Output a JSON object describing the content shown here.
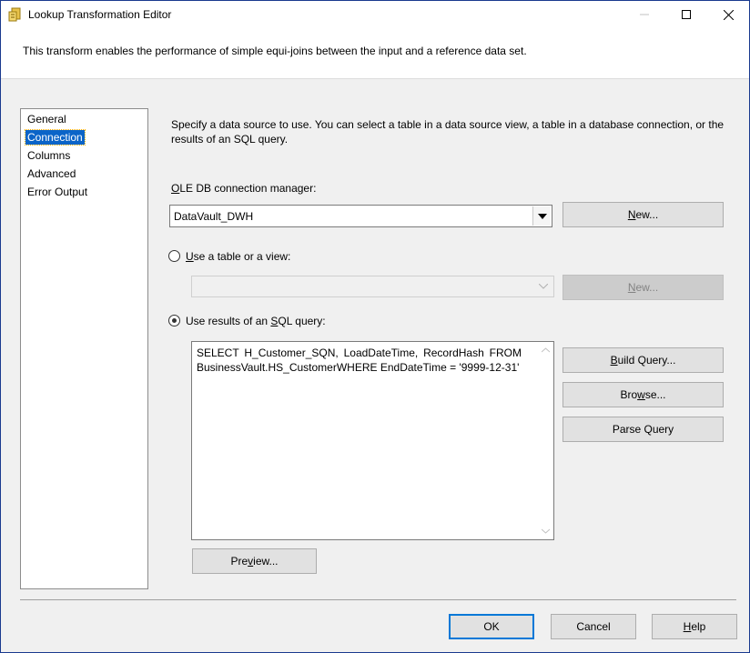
{
  "window": {
    "title": "Lookup Transformation Editor",
    "description": "This transform enables the performance of simple equi-joins between the input and a reference data set."
  },
  "nav": {
    "items": [
      {
        "label": "General",
        "selected": false
      },
      {
        "label": "Connection",
        "selected": true
      },
      {
        "label": "Columns",
        "selected": false
      },
      {
        "label": "Advanced",
        "selected": false
      },
      {
        "label": "Error Output",
        "selected": false
      }
    ]
  },
  "connection": {
    "instructions_line1": "Specify a data source to use. You can select a table in a data source view, a table in a database connection, or the",
    "instructions_line2": "results of an SQL query.",
    "ole_db_label_access": "O",
    "ole_db_label_rest": "LE DB connection manager:",
    "ole_db_value": "DataVault_DWH",
    "new_button_access": "N",
    "new_button_rest": "ew...",
    "use_table_access": "U",
    "use_table_rest": "se a table or a view:",
    "use_table_selected": false,
    "table_value": "",
    "new_button2_access": "N",
    "new_button2_rest": "ew...",
    "use_sql_pre": "Use results of an ",
    "use_sql_access": "S",
    "use_sql_rest": "QL query:",
    "use_sql_selected": true,
    "sql_query": "SELECT H_Customer_SQN, LoadDateTime, RecordHash FROM BusinessVault.HS_CustomerWHERE EndDateTime = '9999-12-31'",
    "build_query_access": "B",
    "build_query_rest": "uild Query...",
    "browse_pre": "Bro",
    "browse_access": "w",
    "browse_rest": "se...",
    "parse_query_label": "Parse Query",
    "preview_pre": "Pre",
    "preview_access": "v",
    "preview_rest": "iew..."
  },
  "footer": {
    "ok_label": "OK",
    "cancel_label": "Cancel",
    "help_access": "H",
    "help_rest": "elp"
  },
  "colors": {
    "selection": "#0a64c8",
    "focus_border": "#0078d7",
    "window_border": "#1a3a8f"
  },
  "icons": {
    "app": "lookup-transform-icon",
    "minimize": "minimize-icon",
    "maximize": "maximize-icon",
    "close": "close-icon"
  }
}
